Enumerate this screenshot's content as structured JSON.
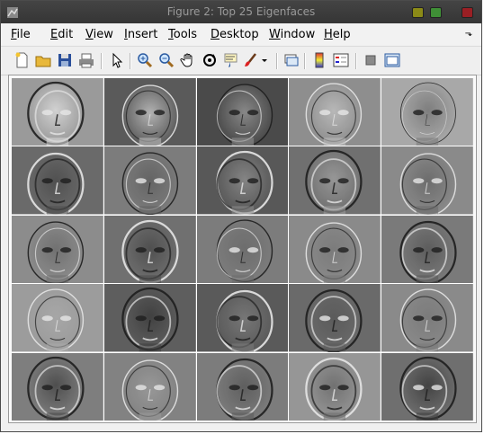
{
  "window": {
    "title": "Figure 2: Top 25 Eigenfaces",
    "button_colors": [
      "#8b8a17",
      "#3f8f36",
      "#9a1f24"
    ]
  },
  "menu": {
    "items": [
      {
        "label": "File",
        "u": "F",
        "rest": "ile"
      },
      {
        "label": "Edit",
        "u": "E",
        "rest": "dit"
      },
      {
        "label": "View",
        "u": "V",
        "rest": "iew"
      },
      {
        "label": "Insert",
        "u": "I",
        "rest": "nsert"
      },
      {
        "label": "Tools",
        "u": "T",
        "rest": "ools"
      },
      {
        "label": "Desktop",
        "u": "D",
        "rest": "esktop"
      },
      {
        "label": "Window",
        "u": "W",
        "rest": "indow"
      },
      {
        "label": "Help",
        "u": "H",
        "rest": "elp"
      }
    ],
    "dock_arrow": "⬎"
  },
  "toolbar": {
    "icons": [
      "new-figure-icon",
      "open-file-icon",
      "save-icon",
      "print-icon",
      "edit-plot-arrow-icon",
      "zoom-in-icon",
      "zoom-out-icon",
      "pan-hand-icon",
      "rotate-3d-icon",
      "data-cursor-icon",
      "brush-icon",
      "brush-dropdown-icon",
      "link-plot-icon",
      "insert-colorbar-icon",
      "insert-legend-icon",
      "hide-plot-tools-icon",
      "show-plot-tools-icon"
    ]
  },
  "eigenfaces": {
    "count": 25,
    "rows": 5,
    "cols": 5,
    "tiles": [
      {
        "bg": "#9a9a9a",
        "face": "#d8d8d8",
        "contrast": "high"
      },
      {
        "bg": "#5a5a5a",
        "face": "#bcbcbc",
        "contrast": "mid"
      },
      {
        "bg": "#4a4a4a",
        "face": "#8f8f8f",
        "contrast": "mid"
      },
      {
        "bg": "#8e8e8e",
        "face": "#bdbdbd",
        "contrast": "mid"
      },
      {
        "bg": "#a8a8a8",
        "face": "#7a7a7a",
        "contrast": "low"
      },
      {
        "bg": "#6a6a6a",
        "face": "#4e4e4e",
        "contrast": "high"
      },
      {
        "bg": "#7c7c7c",
        "face": "#626262",
        "contrast": "mid"
      },
      {
        "bg": "#585858",
        "face": "#8a8a8a",
        "contrast": "high"
      },
      {
        "bg": "#707070",
        "face": "#9b9b9b",
        "contrast": "high"
      },
      {
        "bg": "#8a8a8a",
        "face": "#6a6a6a",
        "contrast": "mid"
      },
      {
        "bg": "#8c8c8c",
        "face": "#6f6f6f",
        "contrast": "mid"
      },
      {
        "bg": "#707070",
        "face": "#4c4c4c",
        "contrast": "high"
      },
      {
        "bg": "#7c7c7c",
        "face": "#6c6c6c",
        "contrast": "mid"
      },
      {
        "bg": "#8a8a8a",
        "face": "#7a7a7a",
        "contrast": "mid"
      },
      {
        "bg": "#7a7a7a",
        "face": "#5a5a5a",
        "contrast": "high"
      },
      {
        "bg": "#9c9c9c",
        "face": "#a8a8a8",
        "contrast": "mid"
      },
      {
        "bg": "#5e5e5e",
        "face": "#3e3e3e",
        "contrast": "high"
      },
      {
        "bg": "#5a5a5a",
        "face": "#7a7a7a",
        "contrast": "high"
      },
      {
        "bg": "#6a6a6a",
        "face": "#5a5a5a",
        "contrast": "high"
      },
      {
        "bg": "#8a8a8a",
        "face": "#7a7a7a",
        "contrast": "mid"
      },
      {
        "bg": "#7e7e7e",
        "face": "#4a4a4a",
        "contrast": "high"
      },
      {
        "bg": "#828282",
        "face": "#9a9a9a",
        "contrast": "mid"
      },
      {
        "bg": "#7c7c7c",
        "face": "#5c5c5c",
        "contrast": "high"
      },
      {
        "bg": "#969696",
        "face": "#6e6e6e",
        "contrast": "high"
      },
      {
        "bg": "#6f6f6f",
        "face": "#3f3f3f",
        "contrast": "high"
      }
    ]
  }
}
